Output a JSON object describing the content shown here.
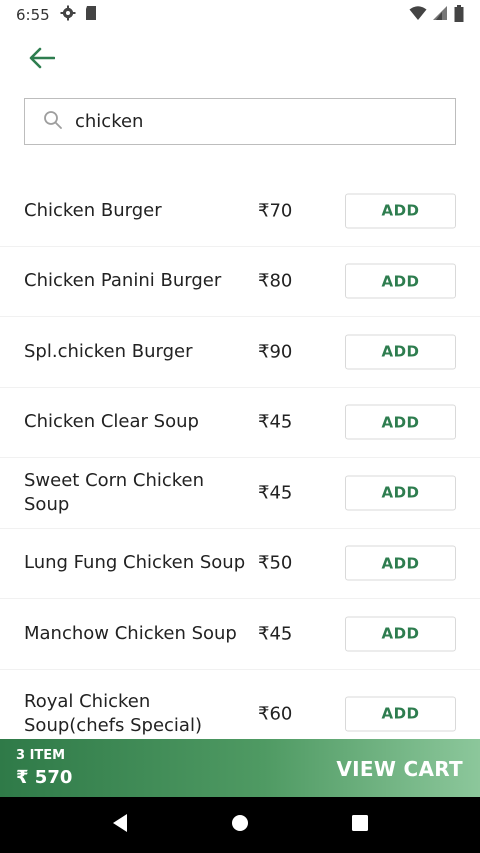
{
  "status": {
    "time": "6:55",
    "left_icons": [
      "gear-icon",
      "sd-card-icon"
    ],
    "right_icons": [
      "wifi-icon",
      "signal-icon",
      "battery-icon"
    ]
  },
  "search": {
    "value": "chicken",
    "icon": "search-icon"
  },
  "items": [
    {
      "name": "Chicken Burger",
      "price": "₹70",
      "action": "ADD"
    },
    {
      "name": "Chicken Panini Burger",
      "price": "₹80",
      "action": "ADD"
    },
    {
      "name": "Spl.chicken Burger",
      "price": "₹90",
      "action": "ADD"
    },
    {
      "name": "Chicken Clear Soup",
      "price": "₹45",
      "action": "ADD"
    },
    {
      "name": "Sweet Corn Chicken Soup",
      "price": "₹45",
      "action": "ADD"
    },
    {
      "name": "Lung Fung Chicken Soup",
      "price": "₹50",
      "action": "ADD"
    },
    {
      "name": "Manchow Chicken Soup",
      "price": "₹45",
      "action": "ADD"
    },
    {
      "name": "Royal Chicken Soup(chefs Special)",
      "price": "₹60",
      "action": "ADD"
    }
  ],
  "cart": {
    "count": "3 ITEM",
    "total": "₹ 570",
    "action": "VIEW CART"
  },
  "colors": {
    "accent": "#2e7d4f",
    "cart_start": "#2f7a48",
    "cart_end": "#8cc79b"
  }
}
